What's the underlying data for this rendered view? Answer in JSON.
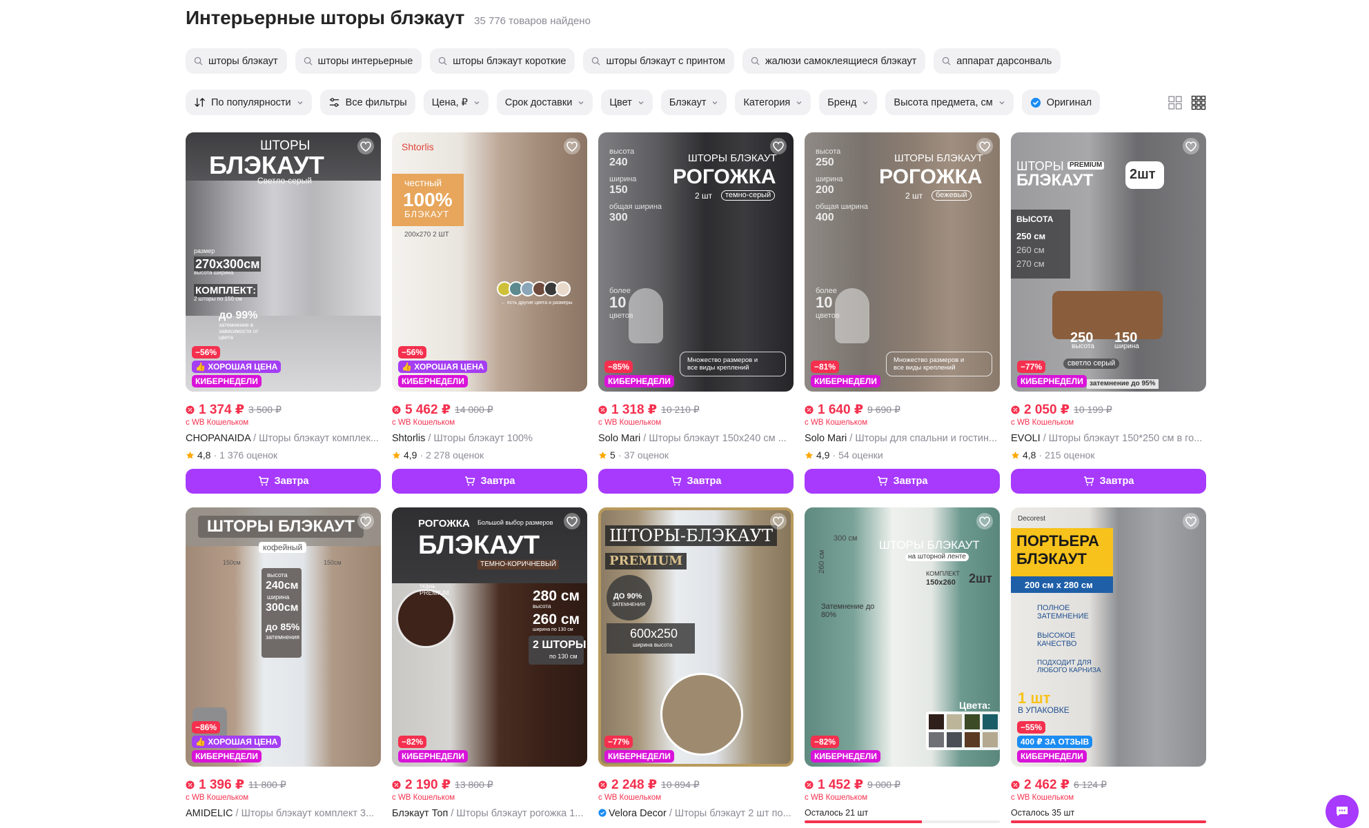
{
  "header": {
    "title": "Интерьерные шторы блэкаут",
    "count": "35 776 товаров найдено"
  },
  "chips": [
    "шторы блэкаут",
    "шторы интерьерные",
    "шторы блэкаут короткие",
    "шторы блэкаут с принтом",
    "жалюзи самоклеящиеся блэкаут",
    "аппарат дарсонваль"
  ],
  "filters": {
    "sort": "По популярности",
    "all": "Все фильтры",
    "items": [
      "Цена, ₽",
      "Срок доставки",
      "Цвет",
      "Блэкаут",
      "Категория",
      "Бренд",
      "Высота предмета, см"
    ],
    "original": "Оригинал"
  },
  "colors": {
    "accent": "#a73afd",
    "price": "#f4304e",
    "cyber": "#d913d9",
    "good": "#a43ff3"
  },
  "common": {
    "wallet": "с WB Кошельком",
    "cart_label": "Завтра",
    "cyber": "КИБЕРНЕДЕЛИ",
    "good_price": "ХОРОШАЯ ЦЕНА"
  },
  "products": [
    {
      "discount": "−56%",
      "good": true,
      "price": "1 374 ₽",
      "old": "3 500 ₽",
      "brand": "CHOPANAIDA",
      "cat": " / Шторы блэкаут комплек...",
      "rating": "4,8",
      "reviews": "1 376 оценок",
      "ov": {
        "t1": "ШТОРЫ",
        "t2": "БЛЭКАУТ",
        "t3": "Светло-серый",
        "t4": "размер",
        "t5": "270x300см",
        "t6": "высота    ширина",
        "t7": "КОМПЛЕКТ:",
        "t8": "2 шторы по 150 см",
        "t9": "до 99%",
        "t10": "затемнение в зависимости от цвета"
      }
    },
    {
      "discount": "−56%",
      "good": true,
      "price": "5 462 ₽",
      "old": "14 000 ₽",
      "brand": "Shtorlis",
      "cat": " / Шторы блэкаут 100%",
      "rating": "4,9",
      "reviews": "2 278 оценок",
      "ov": {
        "t1": "Shtorlis",
        "t2": "честный",
        "t3": "100%",
        "t4": "БЛЭКАУТ",
        "t5": "200x270   2 ШТ",
        "t6": "← есть другие цвета и размеры"
      }
    },
    {
      "discount": "−85%",
      "good": false,
      "price": "1 318 ₽",
      "old": "10 210 ₽",
      "brand": "Solo Mari",
      "cat": " / Шторы блэкаут 150x240 см ...",
      "rating": "5",
      "reviews": "37 оценок",
      "ov": {
        "t1": "ШТОРЫ БЛЭКАУТ",
        "t2": "РОГОЖКА",
        "t3": "2 шт",
        "t4": "темно-серый",
        "t5": "240",
        "t6": "150",
        "t7": "300",
        "t8": "10",
        "t9": "Множество размеров и все виды креплений"
      }
    },
    {
      "discount": "−81%",
      "good": false,
      "price": "1 640 ₽",
      "old": "9 690 ₽",
      "brand": "Solo Mari",
      "cat": " / Шторы для спальни и гостин...",
      "rating": "4,9",
      "reviews": "54 оценки",
      "ov": {
        "t1": "ШТОРЫ БЛЭКАУТ",
        "t2": "РОГОЖКА",
        "t3": "2 шт",
        "t4": "бежевый",
        "t5": "250",
        "t6": "200",
        "t7": "400",
        "t8": "10",
        "t9": "Множество размеров и все виды креплений"
      }
    },
    {
      "discount": "−77%",
      "good": false,
      "price": "2 050 ₽",
      "old": "10 199 ₽",
      "brand": "EVOLI",
      "cat": " / Шторы блэкаут 150*250 см в го...",
      "rating": "4,8",
      "reviews": "215 оценок",
      "ov": {
        "t1": "ШТОРЫ",
        "t2": "PREMIUM",
        "t3": "БЛЭКАУТ",
        "t4": "2шт",
        "t5": "ВЫСОТА",
        "t6": "250 см",
        "t7": "260 см",
        "t8": "270 см",
        "t9": "250",
        "t10": "150",
        "t11": "высота",
        "t12": "ширина",
        "t13": "светло серый",
        "t14": "затемнение до 95%"
      }
    },
    {
      "discount": "−86%",
      "good": true,
      "price": "1 396 ₽",
      "old": "11 800 ₽",
      "brand": "AMIDELIC",
      "cat": " / Шторы блэкаут комплект 3...",
      "ov": {
        "t1": "ШТОРЫ БЛЭКАУТ",
        "t2": "кофейный",
        "t3": "150см",
        "t4": "150см",
        "t5": "высота",
        "t6": "240см",
        "t7": "ширина",
        "t8": "300см",
        "t9": "до 85%",
        "t10": "затемнения"
      }
    },
    {
      "discount": "−82%",
      "good": false,
      "price": "2 190 ₽",
      "old": "13 800 ₽",
      "brand": "Блэкаут Топ",
      "cat": " / Шторы блэкаут рогожка 1...",
      "ov": {
        "t1": "РОГОЖКА",
        "t2": "Большой выбор размеров",
        "t3": "БЛЭКАУТ",
        "t4": "ТЕМНО-КОРИЧНЕВЫЙ",
        "t5": "ткань PREMIUM",
        "t6": "280 см",
        "t7": "высота",
        "t8": "260 см",
        "t9": "ширина по 130 см",
        "t10": "2 ШТОРЫ",
        "t11": "по 130 см"
      }
    },
    {
      "discount": "−77%",
      "good": false,
      "price": "2 248 ₽",
      "old": "10 894 ₽",
      "brand": "Velora Decor",
      "cat": " / Шторы блэкаут 2 шт по...",
      "ov": {
        "t1": "ШТОРЫ-БЛЭКАУТ",
        "t2": "PREMIUM",
        "t3": "ДО 90%",
        "t4": "ЗАТЕМНЕНИЯ",
        "t5": "600x250",
        "t6": "ширина   высота"
      }
    },
    {
      "discount": "−82%",
      "good": false,
      "price": "1 452 ₽",
      "old": "9 000 ₽",
      "brand": "",
      "cat": "",
      "stock": "Осталось 21 шт",
      "stock_fraction": 0.6,
      "ov": {
        "t1": "300 см",
        "t2": "ШТОРЫ БЛЭКАУТ",
        "t3": "на шторной ленте",
        "t4": "КОМПЛЕКТ",
        "t5": "150x260",
        "t6": "2шт",
        "t7": "260 см",
        "t8": "Затемнение до 80%",
        "t9": "Цвета:"
      }
    },
    {
      "discount": "−55%",
      "good": false,
      "review_badge": "400 ₽ ЗА ОТЗЫВ",
      "price": "2 462 ₽",
      "old": "6 124 ₽",
      "brand": "",
      "cat": "",
      "stock": "Осталось 35 шт",
      "stock_fraction": 1.0,
      "ov": {
        "t1": "Decorest",
        "t2": "ПОРТЬЕРА",
        "t3": "БЛЭКАУТ",
        "t4": "200 см x 280 см",
        "t5": "ПОЛНОЕ ЗАТЕМНЕНИЕ",
        "t6": "ВЫСОКОЕ КАЧЕСТВО",
        "t7": "ПОДХОДИТ ДЛЯ ЛЮБОГО КАРНИЗА",
        "t8": "1 шт",
        "t9": "В УПАКОВКЕ"
      }
    }
  ]
}
